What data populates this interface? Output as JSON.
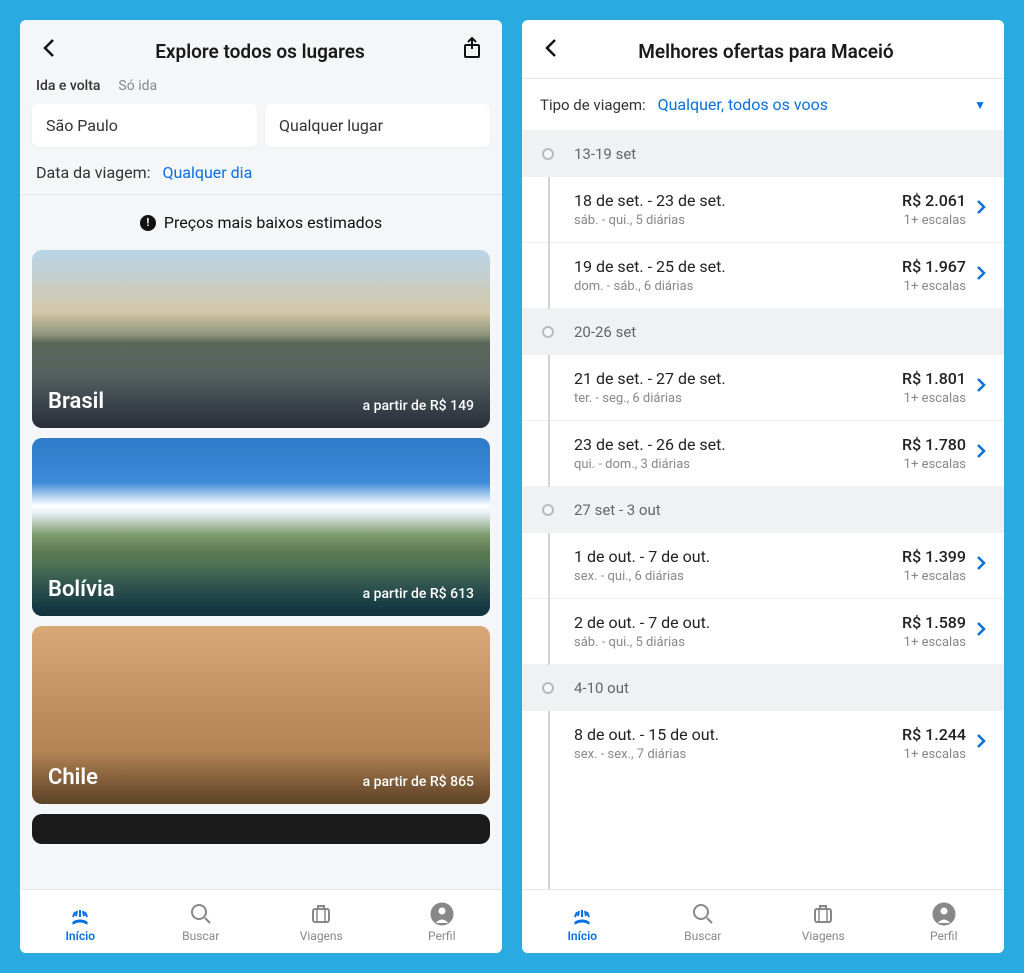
{
  "left": {
    "header_title": "Explore todos os lugares",
    "trip_tabs": {
      "roundtrip": "Ida e volta",
      "oneway": "Só ida"
    },
    "from": "São Paulo",
    "to": "Qualquer lugar",
    "date_label": "Data da viagem:",
    "date_value": "Qualquer dia",
    "price_info": "Preços mais baixos estimados",
    "price_prefix": "a partir de",
    "dests": [
      {
        "name": "Brasil",
        "price": "R$ 149"
      },
      {
        "name": "Bolívia",
        "price": "R$ 613"
      },
      {
        "name": "Chile",
        "price": "R$ 865"
      }
    ]
  },
  "right": {
    "header_title": "Melhores ofertas para Maceió",
    "type_label": "Tipo de viagem:",
    "type_value": "Qualquer, todos os voos",
    "weeks": [
      {
        "label": "13-19 set",
        "deals": [
          {
            "dates": "18 de set. - 23 de set.",
            "meta": "sáb. - qui., 5 diárias",
            "price": "R$ 2.061",
            "stops": "1+ escalas"
          },
          {
            "dates": "19 de set. - 25 de set.",
            "meta": "dom. - sáb., 6 diárias",
            "price": "R$ 1.967",
            "stops": "1+ escalas"
          }
        ]
      },
      {
        "label": "20-26 set",
        "deals": [
          {
            "dates": "21 de set. - 27 de set.",
            "meta": "ter. - seg., 6 diárias",
            "price": "R$ 1.801",
            "stops": "1+ escalas"
          },
          {
            "dates": "23 de set. - 26 de set.",
            "meta": "qui. - dom., 3 diárias",
            "price": "R$ 1.780",
            "stops": "1+ escalas"
          }
        ]
      },
      {
        "label": "27 set - 3 out",
        "deals": [
          {
            "dates": "1 de out. - 7 de out.",
            "meta": "sex. - qui., 6 diárias",
            "price": "R$ 1.399",
            "stops": "1+ escalas"
          },
          {
            "dates": "2 de out. - 7 de out.",
            "meta": "sáb. - qui., 5 diárias",
            "price": "R$ 1.589",
            "stops": "1+ escalas"
          }
        ]
      },
      {
        "label": "4-10 out",
        "deals": [
          {
            "dates": "8 de out. - 15 de out.",
            "meta": "sex. - sex., 7 diárias",
            "price": "R$ 1.244",
            "stops": "1+ escalas"
          }
        ]
      }
    ]
  },
  "tabs": {
    "home": "Início",
    "search": "Buscar",
    "trips": "Viagens",
    "profile": "Perfil"
  }
}
